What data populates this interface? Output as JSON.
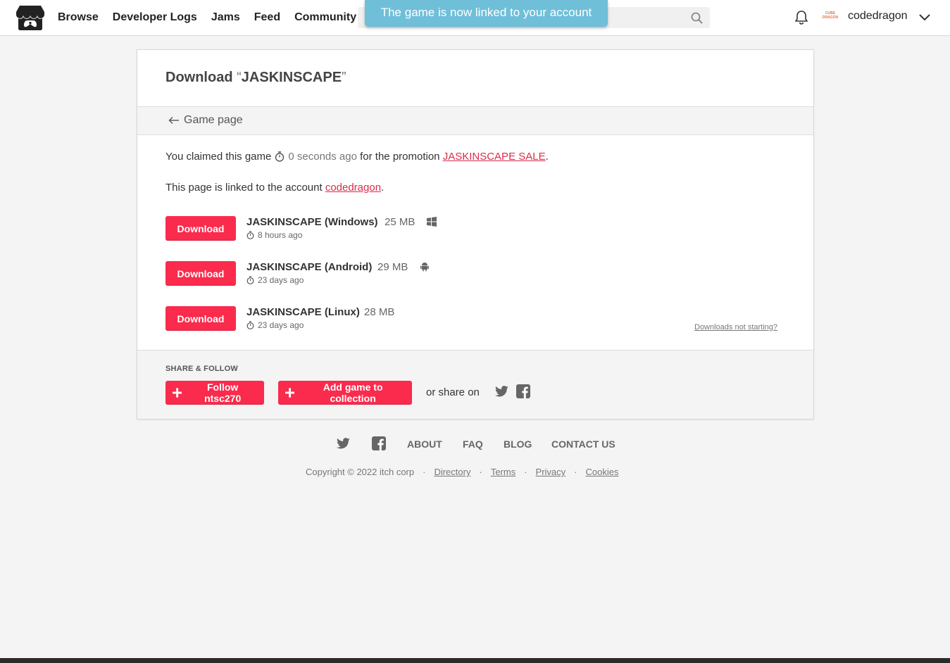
{
  "header": {
    "nav": [
      "Browse",
      "Developer Logs",
      "Jams",
      "Feed",
      "Community"
    ],
    "search_placeholder": "",
    "toast": "The game is now linked to your account",
    "avatar_text": "CUBE DRAGON",
    "username": "codedragon",
    "icons": [
      "itchio-logo-icon",
      "search-icon",
      "bell-icon",
      "chevron-down-icon"
    ]
  },
  "card": {
    "title_prefix": "Download ",
    "open_quote": "“",
    "game_name": "JASKINSCAPE",
    "close_quote": "”",
    "back_link": "Game page",
    "claim": {
      "prefix": "You claimed this game",
      "time": "0 seconds ago",
      "middle": "for the promotion",
      "promo": "JASKINSCAPE SALE",
      "suffix": "."
    },
    "linked": {
      "prefix": "This page is linked to the account",
      "account": "codedragon",
      "suffix": "."
    },
    "downloads": [
      {
        "button": "Download",
        "name": "JASKINSCAPE (Windows)",
        "size": "25 MB",
        "platform": "windows-icon",
        "time": "8 hours ago"
      },
      {
        "button": "Download",
        "name": "JASKINSCAPE (Android)",
        "size": "29 MB",
        "platform": "android-icon",
        "time": "23 days ago"
      },
      {
        "button": "Download",
        "name": "JASKINSCAPE (Linux)",
        "size": "28 MB",
        "platform": "",
        "time": "23 days ago"
      }
    ],
    "not_starting": "Downloads not starting?",
    "share": {
      "label": "SHARE & FOLLOW",
      "follow_button": "Follow ntsc270",
      "collection_button": "Add game to collection",
      "or_share": "or share on",
      "icons": [
        "twitter-icon",
        "facebook-icon"
      ]
    }
  },
  "footer": {
    "links": [
      "ABOUT",
      "FAQ",
      "BLOG",
      "CONTACT US"
    ],
    "copyright": "Copyright © 2022 itch corp",
    "legal": [
      "Directory",
      "Terms",
      "Privacy",
      "Cookies"
    ],
    "separator": "·"
  },
  "colors": {
    "accent": "#fa2b4c",
    "link": "#da2c49",
    "toast": "#6fbfd9"
  }
}
